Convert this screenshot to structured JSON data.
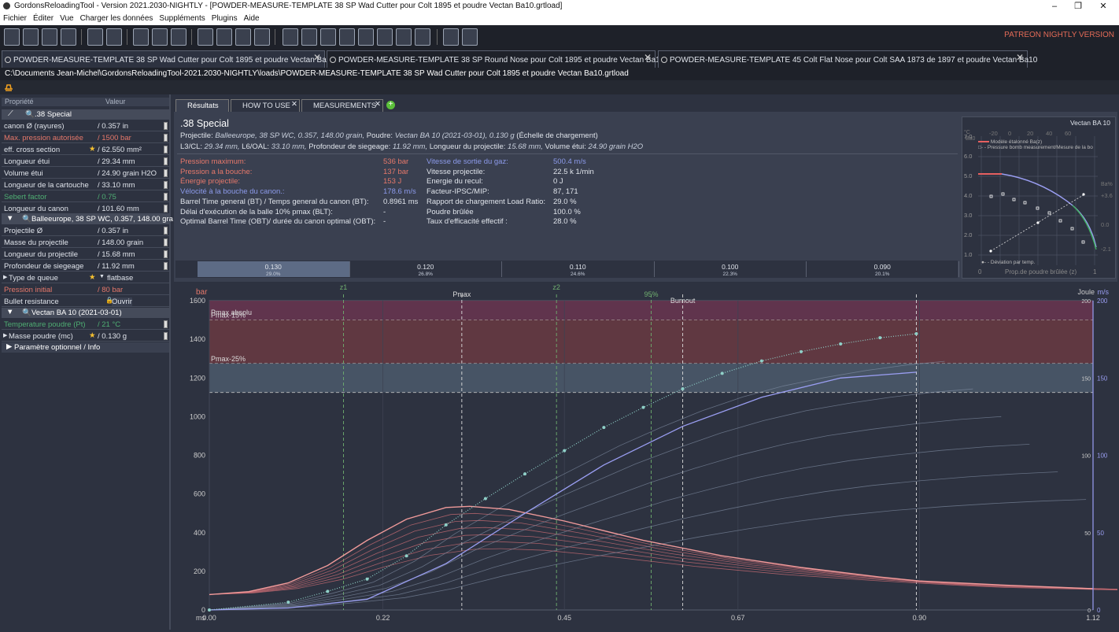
{
  "window": {
    "title": "GordonsReloadingTool - Version 2021.2030-NIGHTLY - [POWDER-MEASURE-TEMPLATE 38 SP Wad Cutter pour Colt 1895 et poudre Vectan Ba10.grtload]",
    "controls": [
      "–",
      "❐",
      "✕"
    ]
  },
  "menu": [
    "Fichier",
    "Éditer",
    "Vue",
    "Charger les données",
    "Suppléments",
    "Plugins",
    "Aide"
  ],
  "patreon": "PATREON NIGHTLY VERSION",
  "tabs": [
    {
      "label": "POWDER-MEASURE-TEMPLATE 38 SP Wad Cutter pour Colt 1895 et poudre Vectan Ba10"
    },
    {
      "label": "POWDER-MEASURE-TEMPLATE 38 SP Round Nose  pour Colt 1895 et poudre Vectan Ba10"
    },
    {
      "label": "POWDER-MEASURE-TEMPLATE 45 Colt Flat Nose pour Colt SAA 1873 de 1897 et poudre Vectan Ba10"
    }
  ],
  "path": "C:\\Documents Jean-Michel\\GordonsReloadingTool-2021.2030-NIGHTLY\\loads\\POWDER-MEASURE-TEMPLATE 38 SP Wad Cutter pour Colt 1895 et poudre Vectan Ba10.grtload",
  "props": {
    "head_key": "Propriété",
    "head_val": "Valeur",
    "cartridge": ".38 Special",
    "rows1": [
      {
        "k": "canon Ø (rayures)",
        "v": "/ 0.357 in",
        "c": ""
      },
      {
        "k": "Max. pression autorisée",
        "v": "/ 1500 bar",
        "c": "red"
      },
      {
        "k": "eff. cross section",
        "v": "/ 62.550 mm²",
        "c": ""
      },
      {
        "k": "Longueur étui",
        "v": "/ 29.34 mm",
        "c": ""
      },
      {
        "k": "Volume étui",
        "v": "/ 24.90 grain H2O",
        "c": ""
      },
      {
        "k": "Longueur de la cartouche",
        "v": "/ 33.10 mm",
        "c": ""
      },
      {
        "k": "Sebert factor",
        "v": "/ 0.75",
        "c": "green"
      },
      {
        "k": "Longueur du canon",
        "v": "/ 101.60 mm",
        "c": ""
      }
    ],
    "projectile": "Balleeurope, 38 SP WC, 0.357, 148.00 gra",
    "rows2": [
      {
        "k": "Projectile Ø",
        "v": "/ 0.357 in",
        "c": ""
      },
      {
        "k": "Masse du projectile",
        "v": "/ 148.00 grain",
        "c": ""
      },
      {
        "k": "Longueur du projectile",
        "v": "/ 15.68 mm",
        "c": ""
      },
      {
        "k": "Profondeur de siegeage",
        "v": "/ 11.92 mm",
        "c": ""
      },
      {
        "k": "Type de queue",
        "v": "flatbase",
        "c": ""
      },
      {
        "k": "Pression initial",
        "v": "/ 80 bar",
        "c": "red"
      },
      {
        "k": "Bullet resistance",
        "v": "Ouvrir",
        "c": ""
      }
    ],
    "powder": "Vectan BA 10 (2021-03-01)",
    "rows3": [
      {
        "k": "Temperature poudre (Pt)",
        "v": "/ 21 °C",
        "c": "green"
      },
      {
        "k": "Masse poudre (mc)",
        "v": "/ 0.130 g",
        "c": ""
      }
    ],
    "optional": "Paramètre optionnel / Info"
  },
  "rtabs": [
    "Résultats",
    "HOW TO USE",
    "MEASUREMENTS"
  ],
  "results": {
    "title": ".38 Special",
    "line1a": "Projectile: ",
    "line1b": "Balleeurope, 38 SP WC, 0.357, 148.00 grain,",
    "line1c": " Poudre: ",
    "line1d": "Vectan BA 10 (2021-03-01), 0.130 g",
    "line1e": " (Échelle de chargement)",
    "line2a": "L3/CL: ",
    "line2b": "29.34 mm,",
    "line2c": " L6/OAL: ",
    "line2d": "33.10 mm,",
    "line2e": " Profondeur de siegeage: ",
    "line2f": "11.92 mm,",
    "line2g": " Longueur du projectile: ",
    "line2h": "15.68 mm,",
    "line2i": " Volume étui: ",
    "line2j": "24.90 grain H2O",
    "left": [
      {
        "k": "Pression maximum:",
        "v": "536 bar",
        "c": "red"
      },
      {
        "k": "Pression a la bouche:",
        "v": "137 bar",
        "c": "red"
      },
      {
        "k": "Énergie projectile:",
        "v": "153 J",
        "c": "red"
      },
      {
        "k": "Vélocité à la bouche du canon.:",
        "v": "178.6 m/s",
        "c": "blue"
      },
      {
        "k": "Barrel Time general (BT) / Temps general du canon (BT):",
        "v": "0.8961 ms",
        "c": ""
      },
      {
        "k": "Délai d'exécution de la balle 10% pmax (BLT):",
        "v": "-",
        "c": ""
      },
      {
        "k": "Optimal Barrel Time (OBT)/ durée du canon optimal (OBT):",
        "v": "-",
        "c": ""
      }
    ],
    "right": [
      {
        "k": "Vitesse de sortie du gaz:",
        "v": "500.4 m/s",
        "c": "blue"
      },
      {
        "k": "Vitesse projectile:",
        "v": "22.5 k 1/min",
        "c": ""
      },
      {
        "k": "Energie du recul:",
        "v": "0 J",
        "c": ""
      },
      {
        "k": "Facteur-IPSC/MIP:",
        "v": "87, 171",
        "c": ""
      },
      {
        "k": "Rapport de chargement Load Ratio:",
        "v": "29.0 %",
        "c": ""
      },
      {
        "k": "Poudre brûlée",
        "v": "100.0 %",
        "c": ""
      },
      {
        "k": "Taux d'efficacité effectif :",
        "v": "28.0 %",
        "c": ""
      }
    ]
  },
  "charges": [
    {
      "mass": "0.130",
      "ratio": "29.0%"
    },
    {
      "mass": "0.120",
      "ratio": "26.8%"
    },
    {
      "mass": "0.110",
      "ratio": "24.6%"
    },
    {
      "mass": "0.100",
      "ratio": "22.3%"
    },
    {
      "mass": "0.090",
      "ratio": "20.1%"
    }
  ],
  "inset": {
    "title": "Vectan BA 10",
    "legend1": "Modèle étalonné Ba(z)",
    "legend2": "Pressure bomb measurement/Mesure de la bo",
    "legend3": "Déviation par temp.",
    "xlabel": "Prop.de poudre brûlée (z)",
    "xmin": "0",
    "xmax": "1",
    "ylabel": "Ba0",
    "yticks": [
      "7.0",
      "6.0",
      "5.0",
      "4.0",
      "3.0",
      "2.0",
      "1.0"
    ],
    "tticks": [
      "-20",
      "0",
      "20",
      "40",
      "60"
    ],
    "tlabel": "°C",
    "rlabel": "Ba%",
    "rticks": [
      "+3.6",
      "0.0",
      "-2.1"
    ]
  },
  "chart_data": {
    "type": "line",
    "xlabel": "ms",
    "ylabel_left": "bar",
    "ylabel_right": "m/s",
    "ylabel_right2": "Joule",
    "xlim": [
      0,
      1.12
    ],
    "ylim": [
      0,
      1600
    ],
    "xticks": [
      "0.00",
      "0.22",
      "0.45",
      "0.67",
      "0.90",
      "1.12"
    ],
    "yticks": [
      "0",
      "200",
      "400",
      "600",
      "800",
      "1000",
      "1200",
      "1400",
      "1600"
    ],
    "rticks": [
      "200",
      "150",
      "100",
      "50",
      "0"
    ],
    "bands": [
      {
        "label": "Pmax absolu",
        "from": 1500,
        "to": 1600,
        "color": "#6a3550"
      },
      {
        "label": "Pmax-15%",
        "from": 1275,
        "to": 1500,
        "color": "#6a3a42"
      },
      {
        "label": "Pmax-25%",
        "from": 1125,
        "to": 1275,
        "color": "#4c5a6c"
      }
    ],
    "markers": [
      {
        "label": "z1",
        "x": 0.17
      },
      {
        "label": "Pmax",
        "x": 0.32
      },
      {
        "label": "z2",
        "x": 0.44
      },
      {
        "label": "95%",
        "x": 0.56
      },
      {
        "label": "Burnout",
        "x": 0.6
      },
      {
        "label": "0.90",
        "x": 0.8961
      }
    ],
    "pressure_main": [
      [
        0,
        80
      ],
      [
        0.05,
        95
      ],
      [
        0.1,
        140
      ],
      [
        0.15,
        230
      ],
      [
        0.2,
        360
      ],
      [
        0.25,
        470
      ],
      [
        0.3,
        530
      ],
      [
        0.33,
        536
      ],
      [
        0.38,
        520
      ],
      [
        0.45,
        460
      ],
      [
        0.55,
        360
      ],
      [
        0.65,
        280
      ],
      [
        0.75,
        220
      ],
      [
        0.85,
        170
      ],
      [
        0.9,
        150
      ],
      [
        1.0,
        130
      ],
      [
        1.12,
        110
      ]
    ],
    "velocity_main": [
      [
        0,
        0
      ],
      [
        0.1,
        5
      ],
      [
        0.15,
        12
      ],
      [
        0.2,
        20
      ],
      [
        0.25,
        35
      ],
      [
        0.3,
        55
      ],
      [
        0.35,
        72
      ],
      [
        0.4,
        88
      ],
      [
        0.45,
        103
      ],
      [
        0.5,
        118
      ],
      [
        0.55,
        131
      ],
      [
        0.6,
        143
      ],
      [
        0.65,
        153
      ],
      [
        0.7,
        161
      ],
      [
        0.75,
        167
      ],
      [
        0.8,
        172
      ],
      [
        0.85,
        176
      ],
      [
        0.8961,
        178.6
      ]
    ],
    "energy_main": [
      [
        0,
        0
      ],
      [
        0.1,
        10
      ],
      [
        0.2,
        55
      ],
      [
        0.3,
        240
      ],
      [
        0.4,
        500
      ],
      [
        0.5,
        750
      ],
      [
        0.6,
        950
      ],
      [
        0.7,
        1100
      ],
      [
        0.8,
        1200
      ],
      [
        0.8961,
        1230
      ]
    ]
  }
}
